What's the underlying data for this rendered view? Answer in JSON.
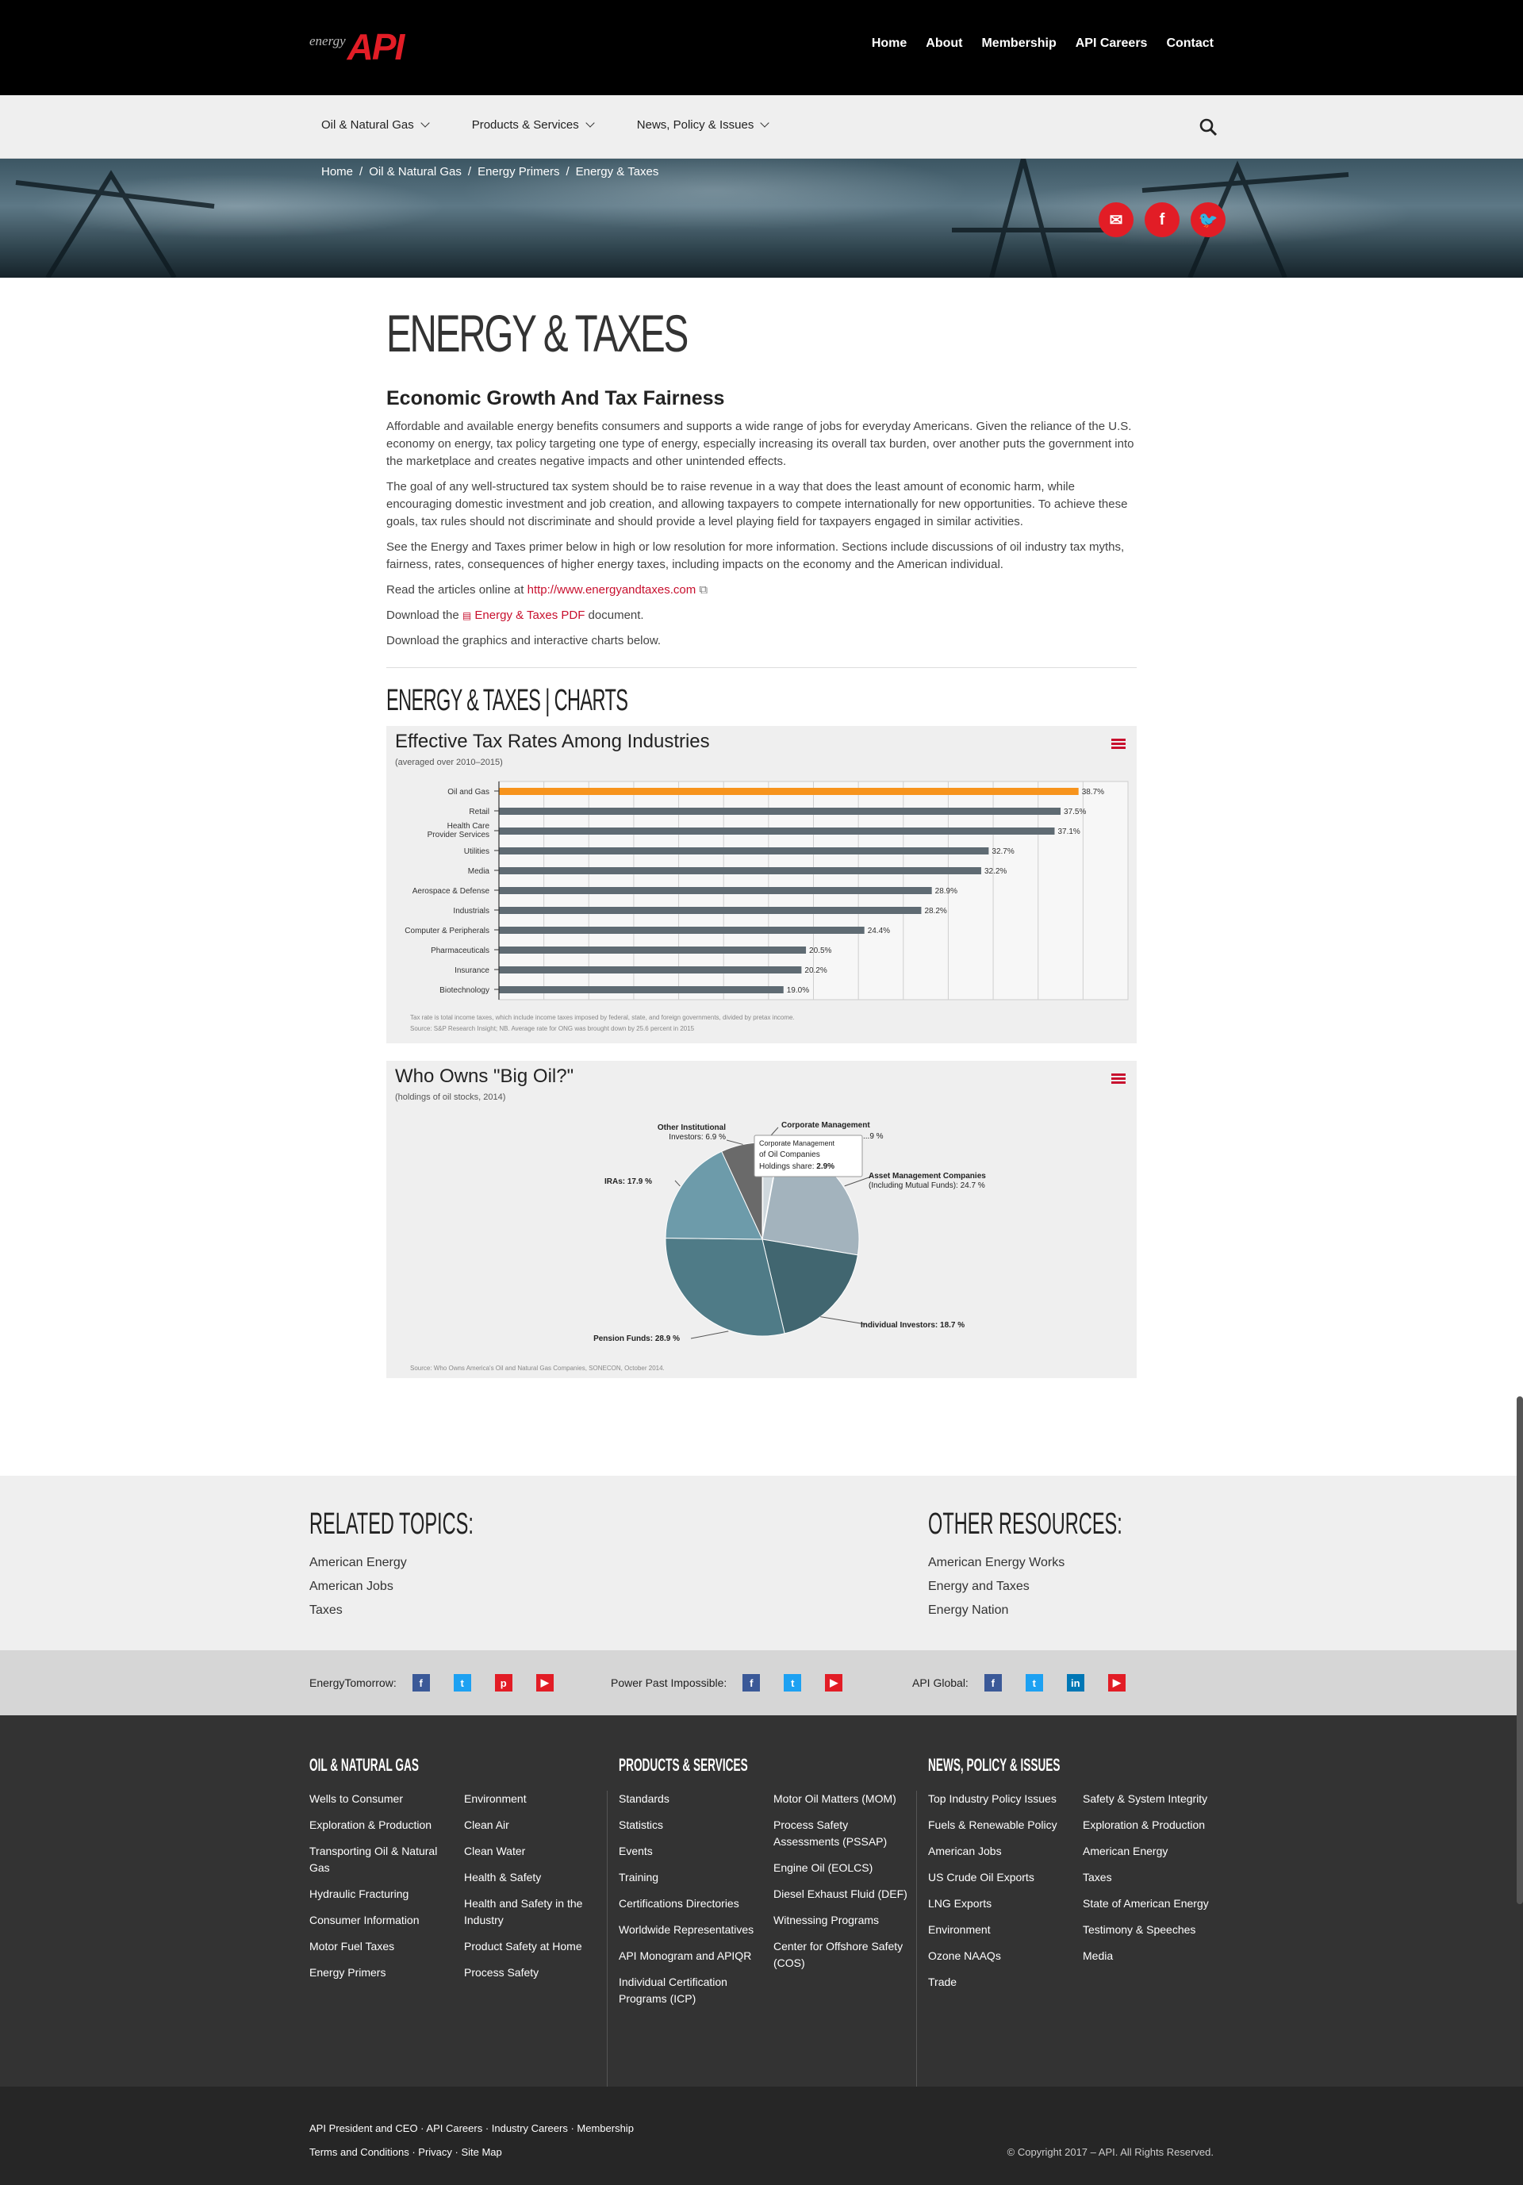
{
  "header": {
    "logo_small": "energy",
    "logo_big": "API",
    "top_nav": [
      "Home",
      "About",
      "Membership",
      "API Careers",
      "Contact"
    ],
    "main_nav": [
      "Oil & Natural Gas",
      "Products & Services",
      "News, Policy & Issues"
    ]
  },
  "breadcrumb": [
    "Home",
    "Oil & Natural Gas",
    "Energy Primers",
    "Energy & Taxes"
  ],
  "page": {
    "title": "ENERGY & TAXES",
    "subhead": "Economic Growth And Tax Fairness",
    "p1": "Affordable and available energy benefits consumers and supports a wide range of jobs for everyday Americans. Given the reliance of the U.S. economy on energy, tax policy targeting one type of energy, especially increasing its overall tax burden, over another puts the government into the marketplace and creates negative impacts and other unintended effects.",
    "p2": "The goal of any well-structured tax system should be to raise revenue in a way that does the least amount of economic harm, while encouraging domestic investment and job creation, and allowing taxpayers to compete internationally for new opportunities. To achieve these goals, tax rules should not discriminate and should provide a level playing field for taxpayers engaged in similar activities.",
    "p3": "See the Energy and Taxes primer below in high or low resolution for more information. Sections include discussions of oil industry tax myths, fairness, rates, consequences of higher energy taxes, including impacts on the economy and the American individual.",
    "read_prefix": "Read the articles online at ",
    "read_link": "http://www.energyandtaxes.com",
    "download_prefix": "Download the ",
    "download_link": "Energy & Taxes PDF",
    "download_suffix": " document.",
    "graphics": "Download the graphics and interactive charts below.",
    "charts_heading": "ENERGY & TAXES | CHARTS"
  },
  "chart_data": [
    {
      "type": "bar",
      "title": "Effective Tax Rates Among Industries",
      "subtitle": "(averaged over 2010–2015)",
      "categories": [
        "Oil and Gas",
        "Retail",
        "Health Care Provider Services",
        "Utilities",
        "Media",
        "Aerospace & Defense",
        "Industrials",
        "Computer & Peripherals",
        "Pharmaceuticals",
        "Insurance",
        "Biotechnology"
      ],
      "values": [
        38.7,
        37.5,
        37.1,
        32.7,
        32.2,
        28.9,
        28.2,
        24.4,
        20.5,
        20.2,
        19.0
      ],
      "value_labels": [
        "38.7%",
        "37.5%",
        "37.1%",
        "32.7%",
        "32.2%",
        "28.9%",
        "28.2%",
        "24.4%",
        "20.5%",
        "20.2%",
        "19.0%"
      ],
      "xlim": [
        0,
        42
      ],
      "grid": true,
      "highlight_color": "#f7941d",
      "bar_color": "#5f6b73",
      "notes": [
        "Tax rate is total income taxes, which include income taxes imposed by federal, state, and foreign governments, divided by pretax income.",
        "Source: S&P Research Insight; NB. Average rate for ONG was brought down by 25.6 percent in 2015"
      ]
    },
    {
      "type": "pie",
      "title": "Who Owns \"Big Oil?\"",
      "subtitle": "(holdings of oil stocks, 2014)",
      "slices": [
        {
          "name": "Corporate Management of Oil Companies",
          "label_text": "Corporate Management",
          "value": 2.9,
          "color": "#cfd8dd"
        },
        {
          "name": "Asset Management Companies (Including Mutual Funds)",
          "label_lines": [
            "Asset Management Companies",
            "(Including Mutual Funds): 24.7 %"
          ],
          "value": 24.7,
          "color": "#a3b3bd"
        },
        {
          "name": "Individual Investors",
          "label_text": "Individual Investors: 18.7 %",
          "value": 18.7,
          "color": "#416670"
        },
        {
          "name": "Pension Funds",
          "label_text": "Pension Funds: 28.9 %",
          "value": 28.9,
          "color": "#4f7b87"
        },
        {
          "name": "IRAs",
          "label_text": "IRAs: 17.9 %",
          "value": 17.9,
          "color": "#6d9baa"
        },
        {
          "name": "Other Institutional Investors",
          "label_lines": [
            "Other Institutional",
            "Investors: 6.9 %"
          ],
          "value": 6.9,
          "color": "#6a6a6a"
        }
      ],
      "tooltip": {
        "line1": "Corporate Management",
        "line2": "of Oil Companies",
        "line3_prefix": "Holdings share: ",
        "line3_value": "2.9%"
      },
      "partial_label": "...9 %",
      "source": "Source: Who Owns America's Oil and Natural Gas Companies, SONECON, October 2014."
    }
  ],
  "related": {
    "heading": "RELATED TOPICS:",
    "items": [
      "American Energy",
      "American Jobs",
      "Taxes"
    ]
  },
  "resources": {
    "heading": "OTHER RESOURCES:",
    "items": [
      "American Energy Works",
      "Energy and Taxes",
      "Energy Nation"
    ]
  },
  "social": [
    {
      "label": "EnergyTomorrow:",
      "icons": [
        "facebook-icon",
        "twitter-icon",
        "pinterest-icon",
        "youtube-icon"
      ]
    },
    {
      "label": "Power Past Impossible:",
      "icons": [
        "facebook-icon",
        "twitter-icon",
        "youtube-icon"
      ]
    },
    {
      "label": "API Global:",
      "icons": [
        "facebook-icon",
        "twitter-icon",
        "linkedin-icon",
        "youtube-icon"
      ]
    }
  ],
  "footer": {
    "col1_head": "OIL & NATURAL GAS",
    "col1a": [
      "Wells to Consumer",
      "Exploration & Production",
      "Transporting Oil & Natural Gas",
      "Hydraulic Fracturing",
      "Consumer Information",
      "Motor Fuel Taxes",
      "Energy Primers"
    ],
    "col1b": [
      "Environment",
      "Clean Air",
      "Clean Water",
      "Health & Safety",
      "Health and Safety in the Industry",
      "Product Safety at Home",
      "Process Safety"
    ],
    "col2_head": "PRODUCTS & SERVICES",
    "col2a": [
      "Standards",
      "Statistics",
      "Events",
      "Training",
      "Certifications Directories",
      "Worldwide Representatives",
      "API Monogram and APIQR",
      "Individual Certification Programs (ICP)"
    ],
    "col2b": [
      "Motor Oil Matters (MOM)",
      "Process Safety Assessments (PSSAP)",
      "Engine Oil (EOLCS)",
      "Diesel Exhaust Fluid (DEF)",
      "Witnessing Programs",
      "Center for Offshore Safety (COS)"
    ],
    "col3_head": "NEWS, POLICY & ISSUES",
    "col3a": [
      "Top Industry Policy Issues",
      "Fuels & Renewable Policy",
      "American Jobs",
      "US Crude Oil Exports",
      "LNG Exports",
      "Environment",
      "Ozone NAAQs",
      "Trade"
    ],
    "col3b": [
      "Safety & System Integrity",
      "Exploration & Production",
      "American Energy",
      "Taxes",
      "State of American Energy",
      "Testimony & Speeches",
      "Media"
    ]
  },
  "bottom": {
    "links1": "API President and CEO · API Careers · Industry Careers · Membership",
    "links2": "Terms and Conditions · Privacy · Site Map",
    "copyright": "© Copyright 2017 – API. All Rights Reserved."
  },
  "colors": {
    "brand_red": "#e21d26",
    "link_red": "#c8102e"
  }
}
